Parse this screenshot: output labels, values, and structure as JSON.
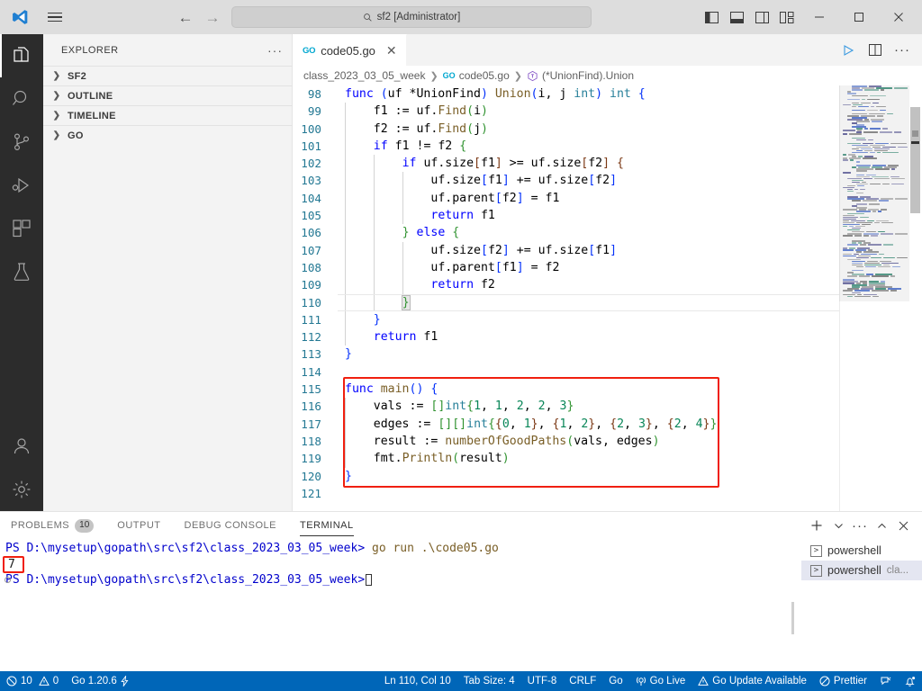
{
  "titlebar": {
    "search_value": "sf2 [Administrator]",
    "back_label": "←",
    "forward_label": "→",
    "search_icon": "search-icon",
    "menu_icon": "hamburger-menu-icon",
    "logo_icon": "vscode-logo-icon",
    "layout_toggles": [
      {
        "name": "toggle-primary-sidebar",
        "label": "primary side bar"
      },
      {
        "name": "toggle-panel",
        "label": "panel"
      },
      {
        "name": "toggle-secondary-sidebar",
        "label": "secondary side bar"
      },
      {
        "name": "customize-layout",
        "label": "customize layout"
      }
    ],
    "window_controls": [
      {
        "name": "minimize-button",
        "label": "minimize"
      },
      {
        "name": "maximize-button",
        "label": "maximize"
      },
      {
        "name": "close-button",
        "label": "close"
      }
    ]
  },
  "activity_bar": {
    "items": [
      {
        "name": "activity-explorer",
        "label": "Explorer",
        "icon": "files-icon",
        "active": true
      },
      {
        "name": "activity-search",
        "label": "Search",
        "icon": "search-icon",
        "active": false
      },
      {
        "name": "activity-source-control",
        "label": "Source Control",
        "icon": "source-control-icon",
        "active": false
      },
      {
        "name": "activity-run-debug",
        "label": "Run and Debug",
        "icon": "run-debug-icon",
        "active": false
      },
      {
        "name": "activity-extensions",
        "label": "Extensions",
        "icon": "extensions-icon",
        "active": false
      },
      {
        "name": "activity-testing",
        "label": "Testing",
        "icon": "beaker-icon",
        "active": false
      }
    ],
    "bottom_items": [
      {
        "name": "activity-accounts",
        "label": "Accounts",
        "icon": "account-icon"
      },
      {
        "name": "activity-settings",
        "label": "Manage",
        "icon": "gear-icon"
      }
    ]
  },
  "sidebar": {
    "title": "EXPLORER",
    "more_label": "···",
    "sections": [
      {
        "name": "sidebar-section-sf2",
        "label": "SF2",
        "expanded": false
      },
      {
        "name": "sidebar-section-outline",
        "label": "OUTLINE",
        "expanded": false
      },
      {
        "name": "sidebar-section-timeline",
        "label": "TIMELINE",
        "expanded": false
      },
      {
        "name": "sidebar-section-go",
        "label": "GO",
        "expanded": false
      }
    ]
  },
  "editor": {
    "tab": {
      "label": "code05.go",
      "icon": "go-file-icon",
      "close_label": "✕",
      "active": true
    },
    "tab_actions": [
      {
        "name": "run-code-button",
        "label": "Run Code"
      },
      {
        "name": "split-editor-button",
        "label": "Split Editor Right"
      },
      {
        "name": "editor-more-actions",
        "label": "···"
      }
    ],
    "breadcrumb": [
      {
        "name": "breadcrumb-folder",
        "label": "class_2023_03_05_week"
      },
      {
        "name": "breadcrumb-file",
        "label": "code05.go",
        "icon": "go-file-icon"
      },
      {
        "name": "breadcrumb-symbol",
        "label": "(*UnionFind).Union",
        "icon": "method-symbol-icon"
      }
    ],
    "first_line_number": 98,
    "current_line": 110,
    "lines": [
      {
        "n": 98,
        "indent": 0,
        "code": "func (uf *UnionFind) Union(i, j int) int {"
      },
      {
        "n": 99,
        "indent": 1,
        "code": "f1 := uf.Find(i)"
      },
      {
        "n": 100,
        "indent": 1,
        "code": "f2 := uf.Find(j)"
      },
      {
        "n": 101,
        "indent": 1,
        "code": "if f1 != f2 {"
      },
      {
        "n": 102,
        "indent": 2,
        "code": "if uf.size[f1] >= uf.size[f2] {"
      },
      {
        "n": 103,
        "indent": 3,
        "code": "uf.size[f1] += uf.size[f2]"
      },
      {
        "n": 104,
        "indent": 3,
        "code": "uf.parent[f2] = f1"
      },
      {
        "n": 105,
        "indent": 3,
        "code": "return f1"
      },
      {
        "n": 106,
        "indent": 2,
        "code": "} else {"
      },
      {
        "n": 107,
        "indent": 3,
        "code": "uf.size[f2] += uf.size[f1]"
      },
      {
        "n": 108,
        "indent": 3,
        "code": "uf.parent[f1] = f2"
      },
      {
        "n": 109,
        "indent": 3,
        "code": "return f2"
      },
      {
        "n": 110,
        "indent": 2,
        "code": "}"
      },
      {
        "n": 111,
        "indent": 1,
        "code": "}"
      },
      {
        "n": 112,
        "indent": 1,
        "code": "return f1"
      },
      {
        "n": 113,
        "indent": 0,
        "code": "}"
      },
      {
        "n": 114,
        "indent": 0,
        "code": ""
      },
      {
        "n": 115,
        "indent": 0,
        "code": "func main() {"
      },
      {
        "n": 116,
        "indent": 1,
        "code": "vals := []int{1, 1, 2, 2, 3}"
      },
      {
        "n": 117,
        "indent": 1,
        "code": "edges := [][]int{{0, 1}, {1, 2}, {2, 3}, {2, 4}}"
      },
      {
        "n": 118,
        "indent": 1,
        "code": "result := numberOfGoodPaths(vals, edges)"
      },
      {
        "n": 119,
        "indent": 1,
        "code": "fmt.Println(result)"
      },
      {
        "n": 120,
        "indent": 0,
        "code": "}"
      },
      {
        "n": 121,
        "indent": 0,
        "code": ""
      }
    ],
    "annotation_color": "#f01f0f"
  },
  "panel": {
    "tabs": [
      {
        "name": "panel-tab-problems",
        "label": "PROBLEMS",
        "badge": "10",
        "active": false
      },
      {
        "name": "panel-tab-output",
        "label": "OUTPUT",
        "badge": "",
        "active": false
      },
      {
        "name": "panel-tab-debug-console",
        "label": "DEBUG CONSOLE",
        "badge": "",
        "active": false
      },
      {
        "name": "panel-tab-terminal",
        "label": "TERMINAL",
        "badge": "",
        "active": true
      }
    ],
    "actions": [
      {
        "name": "new-terminal-button",
        "label": "+"
      },
      {
        "name": "terminal-dropdown-button",
        "label": "⌄"
      },
      {
        "name": "panel-more-actions",
        "label": "···"
      },
      {
        "name": "maximize-panel-button",
        "label": "^"
      },
      {
        "name": "close-panel-button",
        "label": "✕"
      }
    ],
    "terminal": {
      "prompt_prefix": "PS ",
      "cwd": "D:\\mysetup\\gopath\\src\\sf2\\class_2023_03_05_week>",
      "command": " go run .\\code05.go",
      "output": "7",
      "output_highlight_color": "#f01f0f",
      "lines": [
        {
          "type": "command",
          "prompt": "PS ",
          "cwd": "D:\\mysetup\\gopath\\src\\sf2\\class_2023_03_05_week>",
          "text": " go run .\\code05.go"
        },
        {
          "type": "output",
          "text": "7"
        },
        {
          "type": "prompt",
          "prompt": "PS ",
          "cwd": "D:\\mysetup\\gopath\\src\\sf2\\class_2023_03_05_week>",
          "text": ""
        }
      ]
    },
    "terminal_list": [
      {
        "name": "terminal-list-item-1",
        "label": "powershell",
        "sublabel": "",
        "active": false
      },
      {
        "name": "terminal-list-item-2",
        "label": "powershell",
        "sublabel": "cla...",
        "active": true
      }
    ]
  },
  "status_bar": {
    "left": [
      {
        "name": "status-errors-warnings",
        "error_icon": "error-circle-icon",
        "errors": "10",
        "warning_icon": "warning-triangle-icon",
        "warnings": "0"
      },
      {
        "name": "status-go-version",
        "label": "Go 1.20.6",
        "icon": "lightning-icon"
      }
    ],
    "right": [
      {
        "name": "status-cursor-position",
        "label": "Ln 110, Col 10"
      },
      {
        "name": "status-tab-size",
        "label": "Tab Size: 4"
      },
      {
        "name": "status-encoding",
        "label": "UTF-8"
      },
      {
        "name": "status-eol",
        "label": "CRLF"
      },
      {
        "name": "status-language-mode",
        "label": "Go"
      },
      {
        "name": "status-go-live",
        "label": "Go Live",
        "icon": "broadcast-icon"
      },
      {
        "name": "status-go-update",
        "label": "Go Update Available",
        "icon": "warning-triangle-icon"
      },
      {
        "name": "status-prettier",
        "label": "Prettier",
        "icon": "prettier-icon"
      },
      {
        "name": "status-feedback",
        "label": "",
        "icon": "feedback-icon"
      },
      {
        "name": "status-notifications",
        "label": "",
        "icon": "bell-dot-icon"
      }
    ],
    "background_color": "#0066b8"
  }
}
